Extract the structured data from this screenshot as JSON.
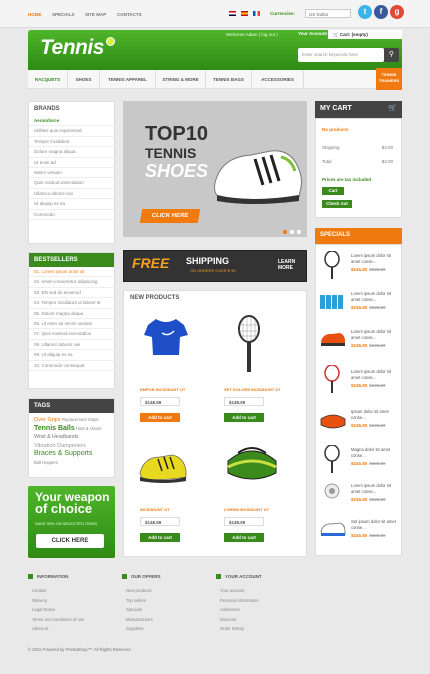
{
  "topbar": {
    "nav": [
      "HOME",
      "SPECIALS",
      "SITE MAP",
      "CONTACTS"
    ],
    "currency_label": "Currencies:",
    "currency_value": "US Dollar",
    "social": [
      "t",
      "f",
      "g"
    ]
  },
  "header": {
    "logo": "Tennis",
    "welcome": "Welcome Adam ( log out )",
    "your_account": "Your Account",
    "cart": "Cart: (empty)",
    "search_placeholder": "Enter search keywords here"
  },
  "nav": {
    "items": [
      "RACQUETS",
      "SHOES",
      "TENNIS APPAREL",
      "STRING & MORE",
      "TENNIS BAGS",
      "ACCESSORIES"
    ],
    "trainers": "TENNIS TRAINERS"
  },
  "brands": {
    "title": "BRANDS",
    "items": [
      "Aeroinforce",
      "Utilities quis experiened",
      "Tempor incididunt",
      "Dolore magna aliqua",
      "Ut enim ad",
      "Minim veniam",
      "Quis nostrud exercitation",
      "Ullamco laboris nisi",
      "Ut aliquip ex ea",
      "Commodo"
    ]
  },
  "bestsellers": {
    "title": "BESTSELLERS",
    "items": [
      "01. Lorem ipsum dolor sit",
      "02. Amet consectetur adipiscing",
      "03. Elit sed do eiusmod",
      "04. Tempor incididunt ut labore et",
      "05. Dolore magna aliqua",
      "06. Ut enim ad minim veniam",
      "07. Quis nostrud exercitation",
      "08. Ullamco laboris nisi",
      "09. Ut aliquip ex ea",
      "10. Commodo consequat"
    ]
  },
  "tags": {
    "title": "TAGS",
    "lines": [
      [
        "Over Grips",
        "Replacement Strips"
      ],
      [
        "Tennis Balls",
        "Hats & Visors"
      ],
      [
        "Wrist & Headbands"
      ],
      [
        "Vibration Dampeners"
      ],
      [
        "Braces & Supports"
      ],
      [
        "Ball Hoppers"
      ]
    ]
  },
  "promo": {
    "line1": "Your weapon",
    "line2": "of choice",
    "line3": "SAVE 30% ON SELECTED ITEMS",
    "button": "CLICK HERE"
  },
  "slider": {
    "line1": "TOP10",
    "line2": "TENNIS",
    "line3": "SHOES",
    "button": "CLICK HERE",
    "active_slide": 2,
    "slide_count": 3
  },
  "shipping": {
    "free": "FREE",
    "shipping": "SHIPPING",
    "sub": "ON ORDERS OVER $ 99",
    "learn": "LEARN",
    "more": "MORE"
  },
  "new_products": {
    "title": "NEW PRODUCTS",
    "products": [
      {
        "name": "EMPOR INCIDIDUNT UT",
        "price": "$148.59",
        "button": "Add to cart"
      },
      {
        "name": "SET DOLORE INCIDIDUNT UT",
        "price": "$148.59",
        "button": "Add to cart"
      },
      {
        "name": "INCIDIDUNT UT",
        "price": "$148.59",
        "button": "Add to cart"
      },
      {
        "name": "LOREM INCIDIDUNT UT",
        "price": "$148.59",
        "button": "Add to cart"
      }
    ]
  },
  "cart": {
    "title": "MY CART",
    "status": "No products",
    "shipping_label": "Shipping",
    "shipping_value": "$3.00",
    "total_label": "Total",
    "total_value": "$3.00",
    "tax_note": "Prices are tax included",
    "cart_button": "Cart",
    "checkout_button": "Check out"
  },
  "specials": {
    "title": "SPECIALS",
    "items": [
      {
        "desc": "Lorem ipsum dolor sit amet conse...",
        "price": "$245.80",
        "old": "$345.80"
      },
      {
        "desc": "Lorem ipsum dolor sit amet conse...",
        "price": "$245.80",
        "old": "$345.80"
      },
      {
        "desc": "Lorem ipsum dolor sit amet conse...",
        "price": "$245.80",
        "old": "$345.80"
      },
      {
        "desc": "Lorem ipsum dolor sit amet conse...",
        "price": "$245.80",
        "old": "$345.80"
      },
      {
        "desc": "Ipsum dolor sit amet conse...",
        "price": "$245.80",
        "old": "$345.80"
      },
      {
        "desc": "Magna dolor sit amet conse...",
        "price": "$245.80",
        "old": "$345.80"
      },
      {
        "desc": "Lorem ipsum dolor sit amet conse...",
        "price": "$245.80",
        "old": "$345.80"
      },
      {
        "desc": "Set ipsum dolor sit amet conse...",
        "price": "$245.80",
        "old": "$345.80"
      }
    ]
  },
  "footer": {
    "information": {
      "title": "INFORMATION",
      "links": [
        "Contact",
        "Delivery",
        "Legal Notice",
        "Terms and conditions of use",
        "About us"
      ]
    },
    "offers": {
      "title": "OUR OFFERS",
      "links": [
        "New products",
        "Top sellers",
        "Specials",
        "Manufacturers",
        "Suppliers"
      ]
    },
    "account": {
      "title": "YOUR ACCOUNT",
      "links": [
        "Your account",
        "Personal information",
        "Addresses",
        "Discount",
        "Order history"
      ]
    },
    "copyright": "© 2011 Powered by PrestaShop™. All Rights Reserved"
  },
  "colors": {
    "green": "#3a8a1c",
    "orange": "#f07a10",
    "dark": "#444444"
  }
}
